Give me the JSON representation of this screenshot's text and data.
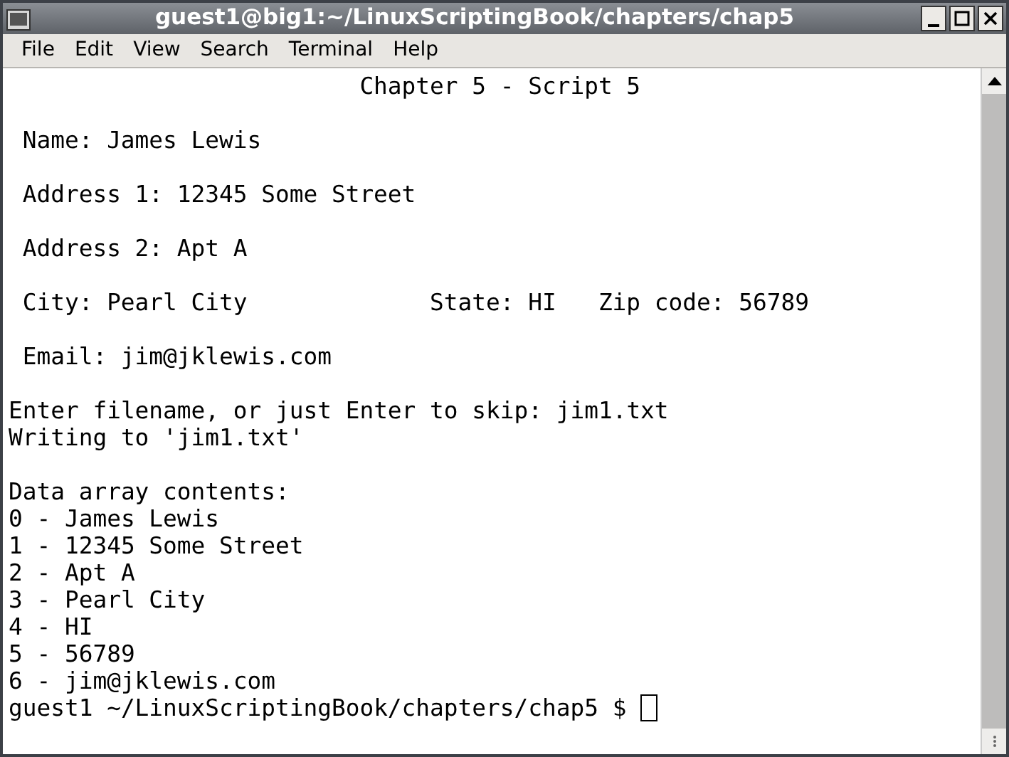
{
  "window": {
    "title": "guest1@big1:~/LinuxScriptingBook/chapters/chap5"
  },
  "menu": [
    "File",
    "Edit",
    "View",
    "Search",
    "Terminal",
    "Help"
  ],
  "terminal": {
    "lines": [
      {
        "kind": "title",
        "text": "Chapter 5 - Script 5"
      },
      {
        "kind": "blank"
      },
      {
        "kind": "indented",
        "text": "Name: James Lewis"
      },
      {
        "kind": "blank"
      },
      {
        "kind": "indented",
        "text": "Address 1: 12345 Some Street"
      },
      {
        "kind": "blank"
      },
      {
        "kind": "indented",
        "text": "Address 2: Apt A"
      },
      {
        "kind": "blank"
      },
      {
        "kind": "fields",
        "fields": [
          "City: Pearl City",
          "State: HI",
          "Zip code: 56789"
        ]
      },
      {
        "kind": "blank"
      },
      {
        "kind": "indented",
        "text": "Email: jim@jklewis.com"
      },
      {
        "kind": "blank"
      },
      {
        "kind": "plain",
        "text": "Enter filename, or just Enter to skip: jim1.txt"
      },
      {
        "kind": "plain",
        "text": "Writing to 'jim1.txt'"
      },
      {
        "kind": "blank"
      },
      {
        "kind": "plain",
        "text": "Data array contents:"
      },
      {
        "kind": "plain",
        "text": "0 - James Lewis"
      },
      {
        "kind": "plain",
        "text": "1 - 12345 Some Street"
      },
      {
        "kind": "plain",
        "text": "2 - Apt A"
      },
      {
        "kind": "plain",
        "text": "3 - Pearl City"
      },
      {
        "kind": "plain",
        "text": "4 - HI"
      },
      {
        "kind": "plain",
        "text": "5 - 56789"
      },
      {
        "kind": "plain",
        "text": "6 - jim@jklewis.com"
      },
      {
        "kind": "prompt",
        "text": "guest1 ~/LinuxScriptingBook/chapters/chap5 $"
      }
    ]
  }
}
